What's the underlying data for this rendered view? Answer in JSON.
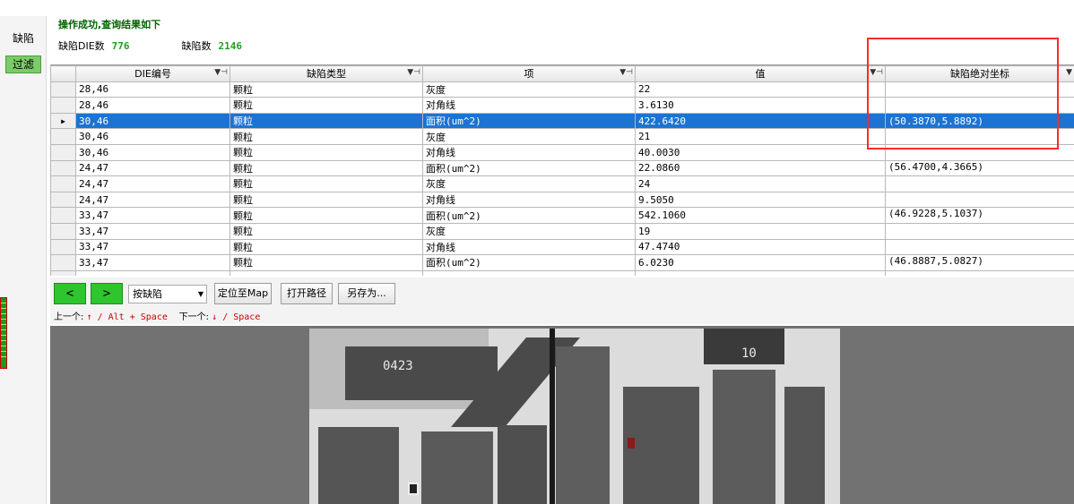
{
  "sidebar": {
    "tab_label": "缺陷",
    "filter_label": "过滤"
  },
  "header": {
    "status_message": "操作成功,查询结果如下",
    "die_count_label": "缺陷DIE数",
    "die_count_value": "776",
    "defect_count_label": "缺陷数",
    "defect_count_value": "2146"
  },
  "grid": {
    "columns": [
      "DIE编号",
      "缺陷类型",
      "项",
      "值",
      "缺陷绝对坐标"
    ],
    "rows": [
      {
        "die": "28,46",
        "type": "颗粒",
        "item": "灰度",
        "value": "22",
        "coord": ""
      },
      {
        "die": "28,46",
        "type": "颗粒",
        "item": "对角线",
        "value": "3.6130",
        "coord": ""
      },
      {
        "die": "30,46",
        "type": "颗粒",
        "item": "面积(um^2)",
        "value": "422.6420",
        "coord": "(50.3870,5.8892)",
        "selected": true
      },
      {
        "die": "30,46",
        "type": "颗粒",
        "item": "灰度",
        "value": "21",
        "coord": ""
      },
      {
        "die": "30,46",
        "type": "颗粒",
        "item": "对角线",
        "value": "40.0030",
        "coord": ""
      },
      {
        "die": "24,47",
        "type": "颗粒",
        "item": "面积(um^2)",
        "value": "22.0860",
        "coord": "(56.4700,4.3665)"
      },
      {
        "die": "24,47",
        "type": "颗粒",
        "item": "灰度",
        "value": "24",
        "coord": ""
      },
      {
        "die": "24,47",
        "type": "颗粒",
        "item": "对角线",
        "value": "9.5050",
        "coord": ""
      },
      {
        "die": "33,47",
        "type": "颗粒",
        "item": "面积(um^2)",
        "value": "542.1060",
        "coord": "(46.9228,5.1037)"
      },
      {
        "die": "33,47",
        "type": "颗粒",
        "item": "灰度",
        "value": "19",
        "coord": ""
      },
      {
        "die": "33,47",
        "type": "颗粒",
        "item": "对角线",
        "value": "47.4740",
        "coord": ""
      },
      {
        "die": "33,47",
        "type": "颗粒",
        "item": "面积(um^2)",
        "value": "6.0230",
        "coord": "(46.8887,5.0827)"
      },
      {
        "die": "",
        "type": "",
        "item": "",
        "value": "",
        "coord": ""
      }
    ]
  },
  "toolbar": {
    "prev_label": "<",
    "next_label": ">",
    "mode_select_value": "按缺陷",
    "locate_label": "定位至Map",
    "open_path_label": "打开路径",
    "save_as_label": "另存为...",
    "prev_hint_label": "上一个:",
    "prev_hint_keys": "↑ / Alt + Space",
    "next_hint_label": "下一个:",
    "next_hint_keys": "↓ / Space"
  },
  "viewer": {
    "label_a": "0423",
    "label_b": "10"
  },
  "colors": {
    "selection": "#1c73d2",
    "highlight": "#ff2a2a",
    "accent_green": "#2ec52e"
  }
}
